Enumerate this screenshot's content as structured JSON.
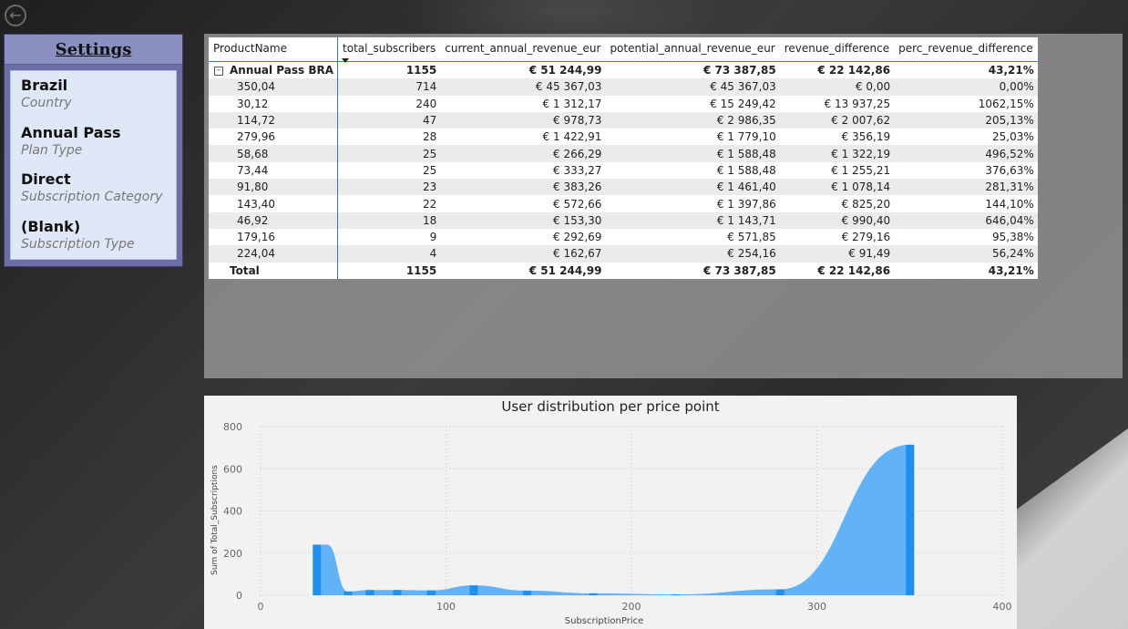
{
  "nav": {
    "back_icon": "arrow-left-icon"
  },
  "settings": {
    "title": "Settings",
    "items": [
      {
        "value": "Brazil",
        "label": "Country"
      },
      {
        "value": "Annual Pass",
        "label": "Plan Type"
      },
      {
        "value": "Direct",
        "label": "Subscription Category"
      },
      {
        "value": "(Blank)",
        "label": "Subscription Type"
      }
    ]
  },
  "table": {
    "columns": [
      "ProductName",
      "total_subscribers",
      "current_annual_revenue_eur",
      "potential_annual_revenue_eur",
      "revenue_difference",
      "perc_revenue_difference"
    ],
    "sorted_column": "total_subscribers",
    "group": {
      "name": "Annual Pass BRA",
      "values": [
        "1155",
        "€ 51 244,99",
        "€ 73 387,85",
        "€ 22 142,86",
        "43,21%"
      ]
    },
    "rows": [
      [
        "350,04",
        "714",
        "€ 45 367,03",
        "€ 45 367,03",
        "€ 0,00",
        "0,00%"
      ],
      [
        "30,12",
        "240",
        "€ 1 312,17",
        "€ 15 249,42",
        "€ 13 937,25",
        "1062,15%"
      ],
      [
        "114,72",
        "47",
        "€ 978,73",
        "€ 2 986,35",
        "€ 2 007,62",
        "205,13%"
      ],
      [
        "279,96",
        "28",
        "€ 1 422,91",
        "€ 1 779,10",
        "€ 356,19",
        "25,03%"
      ],
      [
        "58,68",
        "25",
        "€ 266,29",
        "€ 1 588,48",
        "€ 1 322,19",
        "496,52%"
      ],
      [
        "73,44",
        "25",
        "€ 333,27",
        "€ 1 588,48",
        "€ 1 255,21",
        "376,63%"
      ],
      [
        "91,80",
        "23",
        "€ 383,26",
        "€ 1 461,40",
        "€ 1 078,14",
        "281,31%"
      ],
      [
        "143,40",
        "22",
        "€ 572,66",
        "€ 1 397,86",
        "€ 825,20",
        "144,10%"
      ],
      [
        "46,92",
        "18",
        "€ 153,30",
        "€ 1 143,71",
        "€ 990,40",
        "646,04%"
      ],
      [
        "179,16",
        "9",
        "€ 292,69",
        "€ 571,85",
        "€ 279,16",
        "95,38%"
      ],
      [
        "224,04",
        "4",
        "€ 162,67",
        "€ 254,16",
        "€ 91,49",
        "56,24%"
      ]
    ],
    "total": [
      "Total",
      "1155",
      "€ 51 244,99",
      "€ 73 387,85",
      "€ 22 142,86",
      "43,21%"
    ]
  },
  "chart_data": {
    "type": "area",
    "title": "User distribution per price point",
    "xlabel": "SubscriptionPrice",
    "ylabel": "Sum of Total_Subscriptions",
    "xlim": [
      0,
      400
    ],
    "ylim": [
      0,
      800
    ],
    "xticks": [
      "0",
      "100",
      "200",
      "300",
      "400"
    ],
    "yticks": [
      "0",
      "200",
      "400",
      "600",
      "800"
    ],
    "grid": true,
    "series_color": "#5aaef8",
    "bar_color": "#1f8ff0",
    "points": [
      {
        "x": 30.12,
        "y": 240
      },
      {
        "x": 46.92,
        "y": 18
      },
      {
        "x": 58.68,
        "y": 25
      },
      {
        "x": 73.44,
        "y": 25
      },
      {
        "x": 91.8,
        "y": 23
      },
      {
        "x": 114.72,
        "y": 47
      },
      {
        "x": 143.4,
        "y": 22
      },
      {
        "x": 179.16,
        "y": 9
      },
      {
        "x": 224.04,
        "y": 4
      },
      {
        "x": 279.96,
        "y": 28
      },
      {
        "x": 350.04,
        "y": 714
      }
    ]
  }
}
